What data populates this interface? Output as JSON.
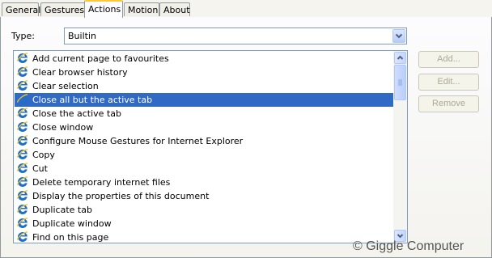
{
  "tabs": [
    {
      "label": "General",
      "active": false
    },
    {
      "label": "Gestures",
      "active": false
    },
    {
      "label": "Actions",
      "active": true
    },
    {
      "label": "Motion",
      "active": false
    },
    {
      "label": "About",
      "active": false
    }
  ],
  "type_field": {
    "label": "Type:",
    "value": "Builtin"
  },
  "actions_list": {
    "items": [
      "Add current page to favourites",
      "Clear browser history",
      "Clear selection",
      "Close all but the active tab",
      "Close the active tab",
      "Close window",
      "Configure Mouse Gestures for Internet Explorer",
      "Copy",
      "Cut",
      "Delete temporary internet files",
      "Display the properties of this document",
      "Duplicate tab",
      "Duplicate window",
      "Find on this page"
    ],
    "selected_index": 3,
    "item_icon": "internet-explorer-icon"
  },
  "buttons": {
    "add": "Add...",
    "edit": "Edit...",
    "remove": "Remove"
  },
  "watermark": "© Giggle Computer",
  "colors": {
    "selection": "#316ac5",
    "active_tab_highlight": "#ffc83c",
    "disabled_text": "#aca899"
  }
}
